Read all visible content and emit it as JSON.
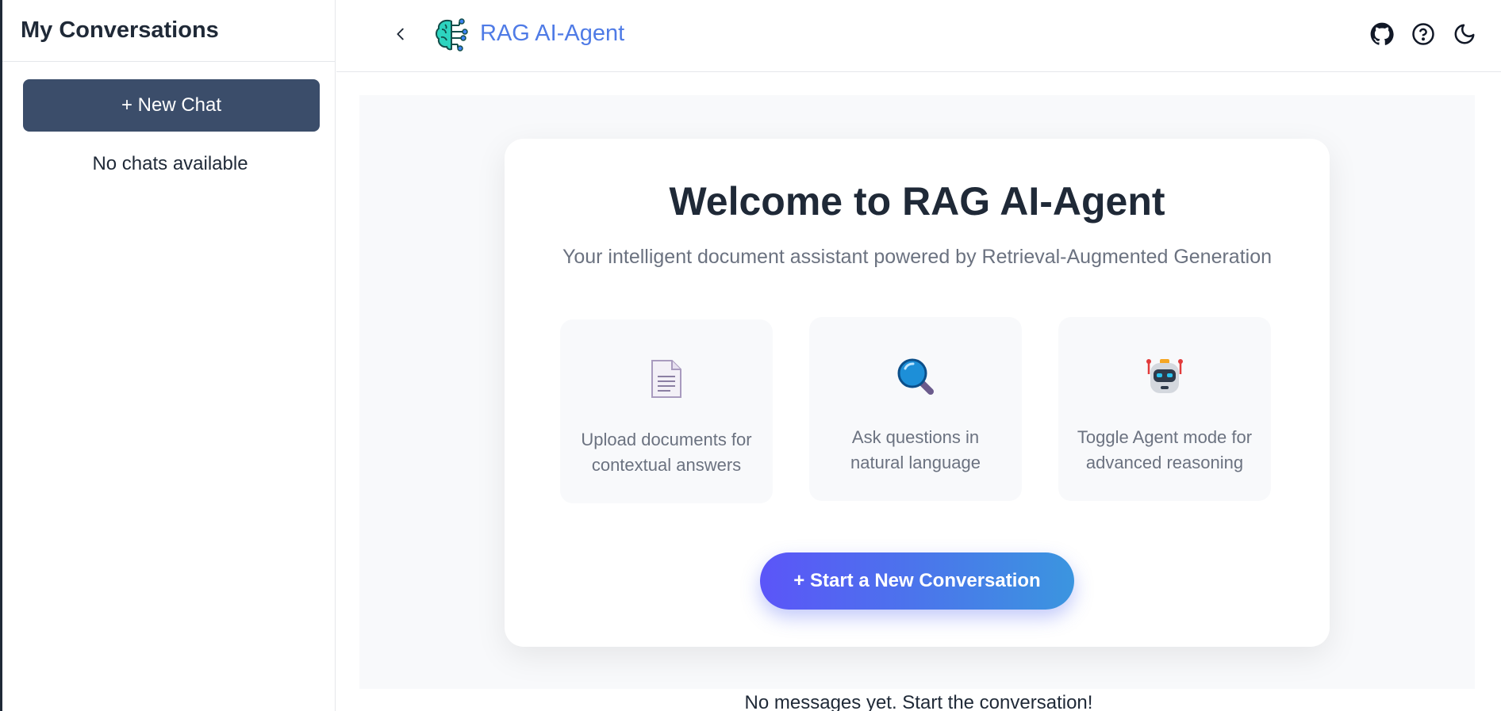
{
  "sidebar": {
    "title": "My Conversations",
    "new_chat_label": "+ New Chat",
    "empty_text": "No chats available"
  },
  "header": {
    "app_title": "RAG AI-Agent",
    "back_icon": "chevron-left-icon",
    "logo_icon": "brain-circuit-icon",
    "icons": [
      "github-icon",
      "help-circle-icon",
      "moon-icon"
    ],
    "title_color": "#4f7be6"
  },
  "welcome": {
    "title": "Welcome to RAG AI-Agent",
    "subtitle": "Your intelligent document assistant powered by Retrieval-Augmented Generation",
    "features": [
      {
        "icon": "document-icon",
        "text": "Upload documents for contextual answers"
      },
      {
        "icon": "magnifier-icon",
        "text": "Ask questions in natural language"
      },
      {
        "icon": "robot-icon",
        "text": "Toggle Agent mode for advanced reasoning"
      }
    ],
    "start_label": "+ Start a New Conversation"
  },
  "footer": {
    "no_messages": "No messages yet. Start the conversation!"
  },
  "colors": {
    "new_chat_button": "#3b4d6a",
    "gradient_start": "#5b55f8",
    "gradient_end": "#3b95df"
  }
}
